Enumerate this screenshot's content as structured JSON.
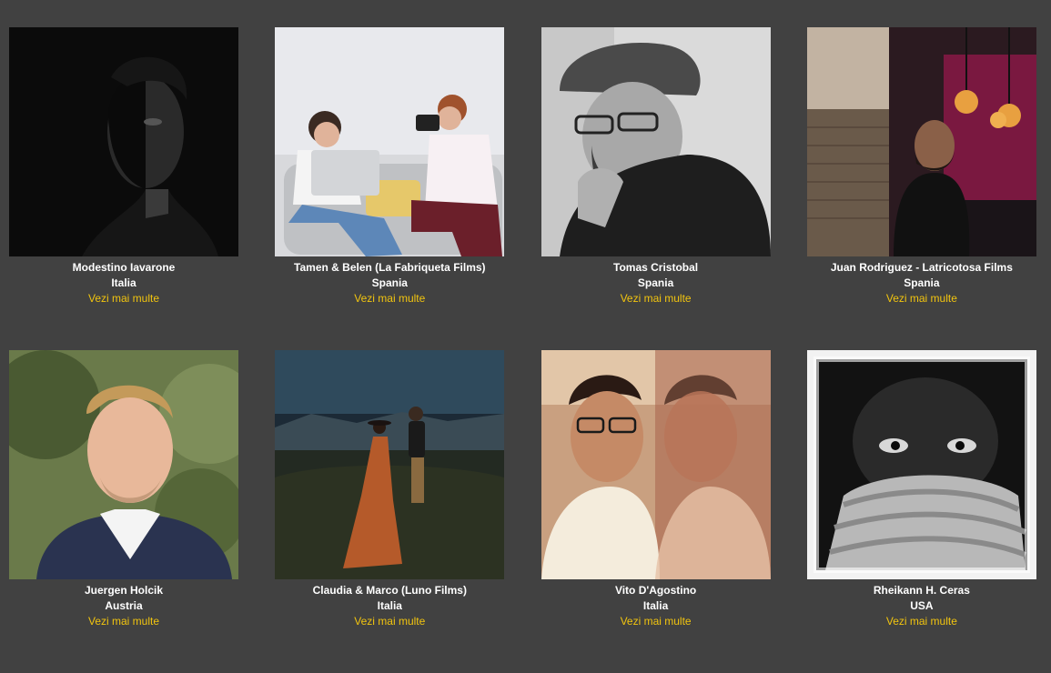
{
  "more_label": "Vezi mai multe",
  "accent_color": "#f1c40f",
  "background_color": "#414141",
  "photographers": [
    {
      "name": "Modestino Iavarone",
      "country": "Italia",
      "photo": "portrait-dark-man"
    },
    {
      "name": "Tamen & Belen (La Fabriqueta Films)",
      "country": "Spania",
      "photo": "two-women-sofa-camera"
    },
    {
      "name": "Tomas Cristobal",
      "country": "Spania",
      "photo": "bw-man-cap-smoking"
    },
    {
      "name": "Juan Rodriguez - Latricotosa Films",
      "country": "Spania",
      "photo": "man-light-bulbs"
    },
    {
      "name": "Juergen Holcik",
      "country": "Austria",
      "photo": "smiling-man-suit"
    },
    {
      "name": "Claudia & Marco (Luno Films)",
      "country": "Italia",
      "photo": "couple-mountain-dress"
    },
    {
      "name": "Vito D'Agostino",
      "country": "Italia",
      "photo": "man-glasses-reflection"
    },
    {
      "name": "Rheikann H. Ceras",
      "country": "USA",
      "photo": "bw-face-scarf"
    }
  ]
}
